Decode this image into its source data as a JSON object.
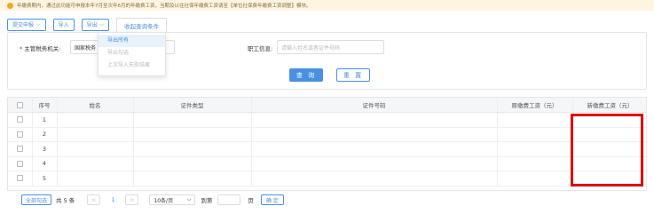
{
  "notice": {
    "icon": "warning-circle-icon",
    "text": "年缴费期内，通过此功能可申报本年7月至次年6月的年缴费工资，当期及以往社保年缴费工资请至【单位社保费年缴费工资调整】模块。"
  },
  "toolbar": {
    "declare_label": "提交申报",
    "import_label": "导入",
    "export_label": "导出",
    "collapse_tab_label": "收起查询条件"
  },
  "export_menu": {
    "items": [
      {
        "label": "导出所有",
        "active": true
      },
      {
        "label": "导出勾选",
        "active": false
      },
      {
        "label": "上次导入失败结果",
        "active": false
      }
    ]
  },
  "form": {
    "tax_authority_label": "主管税务机关:",
    "tax_authority_value": "国家税务",
    "employee_label": "职工信息:",
    "employee_placeholder": "请输入姓名或者证件号码",
    "query_label": "查 询",
    "reset_label": "重 置"
  },
  "table": {
    "headers": [
      "序号",
      "姓名",
      "证件类型",
      "证件号码",
      "原缴费工资（元）",
      "新缴费工资（元）"
    ],
    "rows": [
      {
        "seq": "1"
      },
      {
        "seq": "2"
      },
      {
        "seq": "3"
      },
      {
        "seq": "4"
      },
      {
        "seq": "5"
      }
    ]
  },
  "pager": {
    "select_all_label": "全部勾选",
    "total_text": "共 5 条",
    "prev": "<",
    "current_page": "1",
    "next": ">",
    "page_size": "10条/页",
    "goto_label": "到第",
    "page_suffix": "页",
    "confirm_label": "确 定"
  },
  "colors": {
    "accent": "#4a90e2",
    "required": "#e02020",
    "highlight": "#e00000",
    "notice_bg": "#fdf5e1"
  }
}
